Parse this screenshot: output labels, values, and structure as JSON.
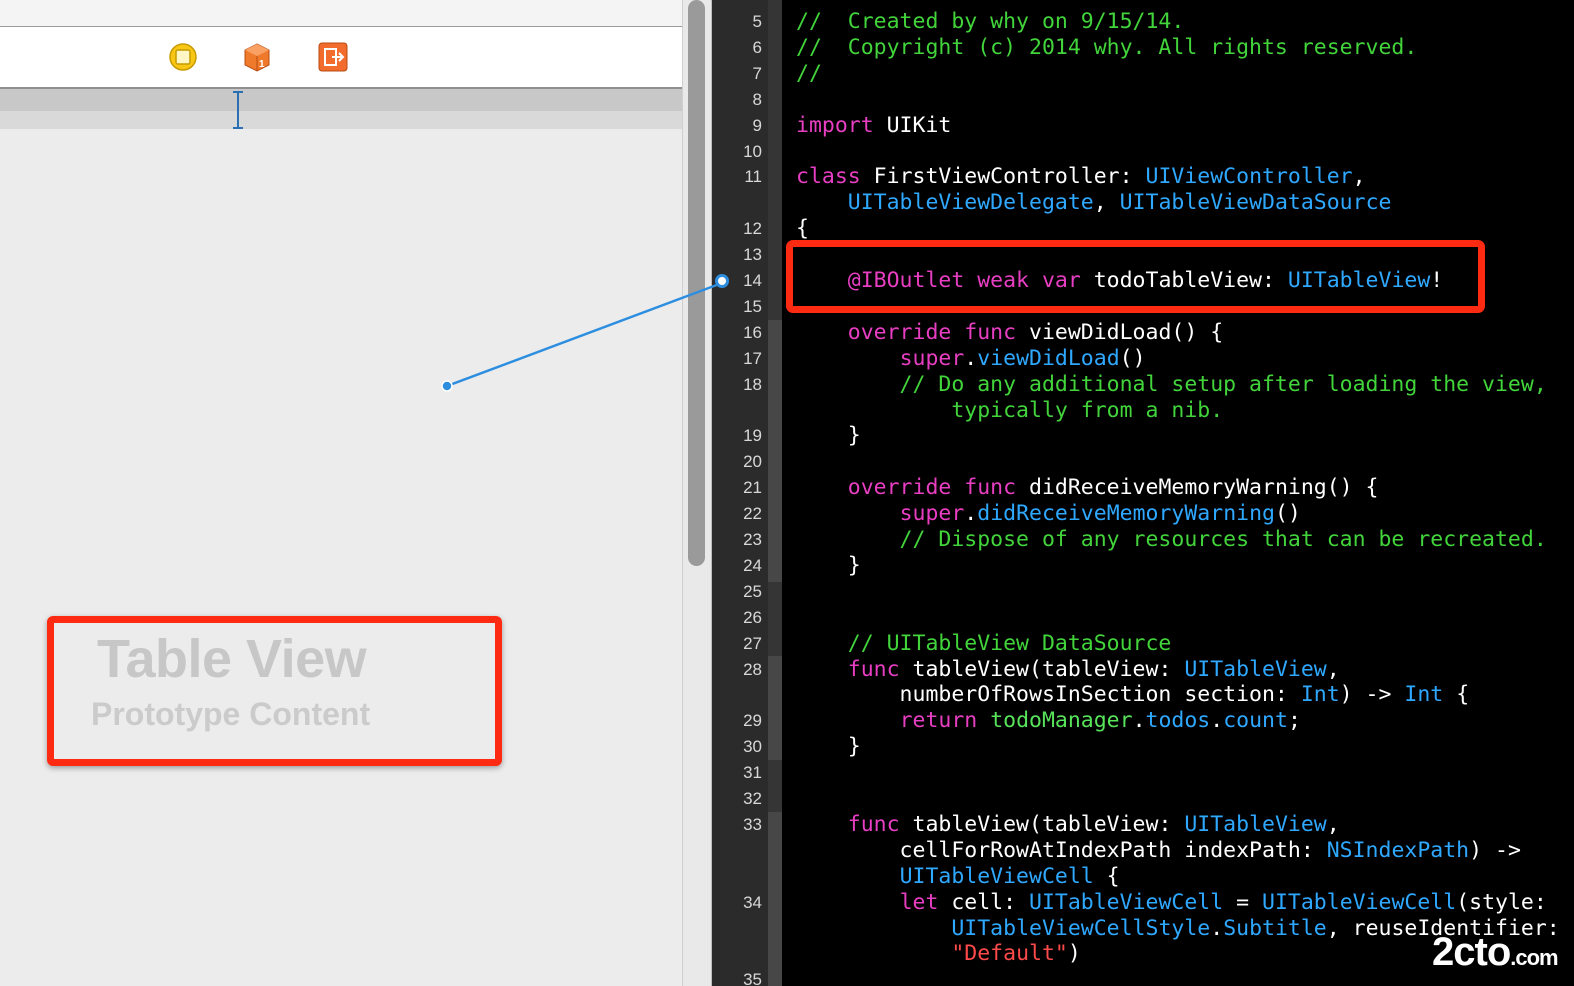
{
  "interface_builder": {
    "dock_icons": [
      "view-controller-icon",
      "first-responder-icon",
      "exit-icon"
    ],
    "table_view": {
      "title": "Table View",
      "subtitle": "Prototype Content"
    }
  },
  "colors": {
    "highlight_red": "#ff2a12",
    "keyword": "#e83ec2",
    "type": "#2fa8ff",
    "comment": "#42d43b",
    "connection": "#2d8ee0"
  },
  "editor": {
    "lines": [
      {
        "num": "5",
        "tokens": [
          {
            "t": "//  Created by why on 9/15/14.",
            "c": "com"
          }
        ]
      },
      {
        "num": "6",
        "tokens": [
          {
            "t": "//  Copyright (c) 2014 why. All rights reserved.",
            "c": "com"
          }
        ]
      },
      {
        "num": "7",
        "tokens": [
          {
            "t": "//",
            "c": "com"
          }
        ]
      },
      {
        "num": "8",
        "tokens": []
      },
      {
        "num": "9",
        "tokens": [
          {
            "t": "import",
            "c": "kw"
          },
          {
            "t": " UIKit",
            "c": "plain"
          }
        ]
      },
      {
        "num": "10",
        "tokens": []
      },
      {
        "num": "11",
        "tokens": [
          {
            "t": "class",
            "c": "kw"
          },
          {
            "t": " FirstViewController: ",
            "c": "plain"
          },
          {
            "t": "UIViewController",
            "c": "type"
          },
          {
            "t": ",",
            "c": "plain"
          }
        ]
      },
      {
        "num": "",
        "tokens": [
          {
            "t": "    ",
            "c": "plain"
          },
          {
            "t": "UITableViewDelegate",
            "c": "type"
          },
          {
            "t": ", ",
            "c": "plain"
          },
          {
            "t": "UITableViewDataSource",
            "c": "type"
          }
        ]
      },
      {
        "num": "12",
        "tokens": [
          {
            "t": "{",
            "c": "plain"
          }
        ]
      },
      {
        "num": "13",
        "tokens": []
      },
      {
        "num": "14",
        "tokens": [
          {
            "t": "    ",
            "c": "plain"
          },
          {
            "t": "@IBOutlet weak var",
            "c": "kw"
          },
          {
            "t": " todoTableView: ",
            "c": "plain"
          },
          {
            "t": "UITableView",
            "c": "type"
          },
          {
            "t": "!",
            "c": "plain"
          }
        ]
      },
      {
        "num": "15",
        "tokens": []
      },
      {
        "num": "16",
        "tokens": [
          {
            "t": "    ",
            "c": "plain"
          },
          {
            "t": "override func",
            "c": "kw"
          },
          {
            "t": " viewDidLoad() {",
            "c": "plain"
          }
        ]
      },
      {
        "num": "17",
        "tokens": [
          {
            "t": "        ",
            "c": "plain"
          },
          {
            "t": "super",
            "c": "kw"
          },
          {
            "t": ".",
            "c": "plain"
          },
          {
            "t": "viewDidLoad",
            "c": "type"
          },
          {
            "t": "()",
            "c": "plain"
          }
        ]
      },
      {
        "num": "18",
        "tokens": [
          {
            "t": "        // Do any additional setup after loading the view,",
            "c": "com"
          }
        ]
      },
      {
        "num": "",
        "tokens": [
          {
            "t": "            typically from a nib.",
            "c": "com"
          }
        ]
      },
      {
        "num": "19",
        "tokens": [
          {
            "t": "    }",
            "c": "plain"
          }
        ]
      },
      {
        "num": "20",
        "tokens": []
      },
      {
        "num": "21",
        "tokens": [
          {
            "t": "    ",
            "c": "plain"
          },
          {
            "t": "override func",
            "c": "kw"
          },
          {
            "t": " didReceiveMemoryWarning() {",
            "c": "plain"
          }
        ]
      },
      {
        "num": "22",
        "tokens": [
          {
            "t": "        ",
            "c": "plain"
          },
          {
            "t": "super",
            "c": "kw"
          },
          {
            "t": ".",
            "c": "plain"
          },
          {
            "t": "didReceiveMemoryWarning",
            "c": "type"
          },
          {
            "t": "()",
            "c": "plain"
          }
        ]
      },
      {
        "num": "23",
        "tokens": [
          {
            "t": "        // Dispose of any resources that can be recreated.",
            "c": "com"
          }
        ]
      },
      {
        "num": "24",
        "tokens": [
          {
            "t": "    }",
            "c": "plain"
          }
        ]
      },
      {
        "num": "25",
        "tokens": []
      },
      {
        "num": "26",
        "tokens": []
      },
      {
        "num": "27",
        "tokens": [
          {
            "t": "    // UITableView DataSource",
            "c": "com"
          }
        ]
      },
      {
        "num": "28",
        "tokens": [
          {
            "t": "    ",
            "c": "plain"
          },
          {
            "t": "func",
            "c": "kw"
          },
          {
            "t": " tableView(tableView: ",
            "c": "plain"
          },
          {
            "t": "UITableView",
            "c": "type"
          },
          {
            "t": ",",
            "c": "plain"
          }
        ]
      },
      {
        "num": "",
        "tokens": [
          {
            "t": "        numberOfRowsInSection section: ",
            "c": "plain"
          },
          {
            "t": "Int",
            "c": "type"
          },
          {
            "t": ") -> ",
            "c": "plain"
          },
          {
            "t": "Int",
            "c": "type"
          },
          {
            "t": " {",
            "c": "plain"
          }
        ]
      },
      {
        "num": "29",
        "tokens": [
          {
            "t": "        ",
            "c": "plain"
          },
          {
            "t": "return",
            "c": "kw"
          },
          {
            "t": " ",
            "c": "plain"
          },
          {
            "t": "todoManager",
            "c": "green"
          },
          {
            "t": ".",
            "c": "plain"
          },
          {
            "t": "todos",
            "c": "type"
          },
          {
            "t": ".",
            "c": "plain"
          },
          {
            "t": "count",
            "c": "type"
          },
          {
            "t": ";",
            "c": "plain"
          }
        ]
      },
      {
        "num": "30",
        "tokens": [
          {
            "t": "    }",
            "c": "plain"
          }
        ]
      },
      {
        "num": "31",
        "tokens": []
      },
      {
        "num": "32",
        "tokens": []
      },
      {
        "num": "33",
        "tokens": [
          {
            "t": "    ",
            "c": "plain"
          },
          {
            "t": "func",
            "c": "kw"
          },
          {
            "t": " tableView(tableView: ",
            "c": "plain"
          },
          {
            "t": "UITableView",
            "c": "type"
          },
          {
            "t": ",",
            "c": "plain"
          }
        ]
      },
      {
        "num": "",
        "tokens": [
          {
            "t": "        cellForRowAtIndexPath indexPath: ",
            "c": "plain"
          },
          {
            "t": "NSIndexPath",
            "c": "type"
          },
          {
            "t": ") ->",
            "c": "plain"
          }
        ]
      },
      {
        "num": "",
        "tokens": [
          {
            "t": "        ",
            "c": "plain"
          },
          {
            "t": "UITableViewCell",
            "c": "type"
          },
          {
            "t": " {",
            "c": "plain"
          }
        ]
      },
      {
        "num": "34",
        "tokens": [
          {
            "t": "        ",
            "c": "plain"
          },
          {
            "t": "let",
            "c": "kw"
          },
          {
            "t": " cell: ",
            "c": "plain"
          },
          {
            "t": "UITableViewCell",
            "c": "type"
          },
          {
            "t": " = ",
            "c": "plain"
          },
          {
            "t": "UITableViewCell",
            "c": "type"
          },
          {
            "t": "(style:",
            "c": "plain"
          }
        ]
      },
      {
        "num": "",
        "tokens": [
          {
            "t": "            ",
            "c": "plain"
          },
          {
            "t": "UITableViewCellStyle",
            "c": "type"
          },
          {
            "t": ".",
            "c": "plain"
          },
          {
            "t": "Subtitle",
            "c": "type"
          },
          {
            "t": ", reuseIdentifier:",
            "c": "plain"
          }
        ]
      },
      {
        "num": "",
        "tokens": [
          {
            "t": "            ",
            "c": "plain"
          },
          {
            "t": "\"Default\"",
            "c": "str"
          },
          {
            "t": ")",
            "c": "plain"
          }
        ]
      },
      {
        "num": "35",
        "tokens": []
      }
    ]
  },
  "watermark": {
    "text": "2cto",
    "suffix": ".com"
  }
}
